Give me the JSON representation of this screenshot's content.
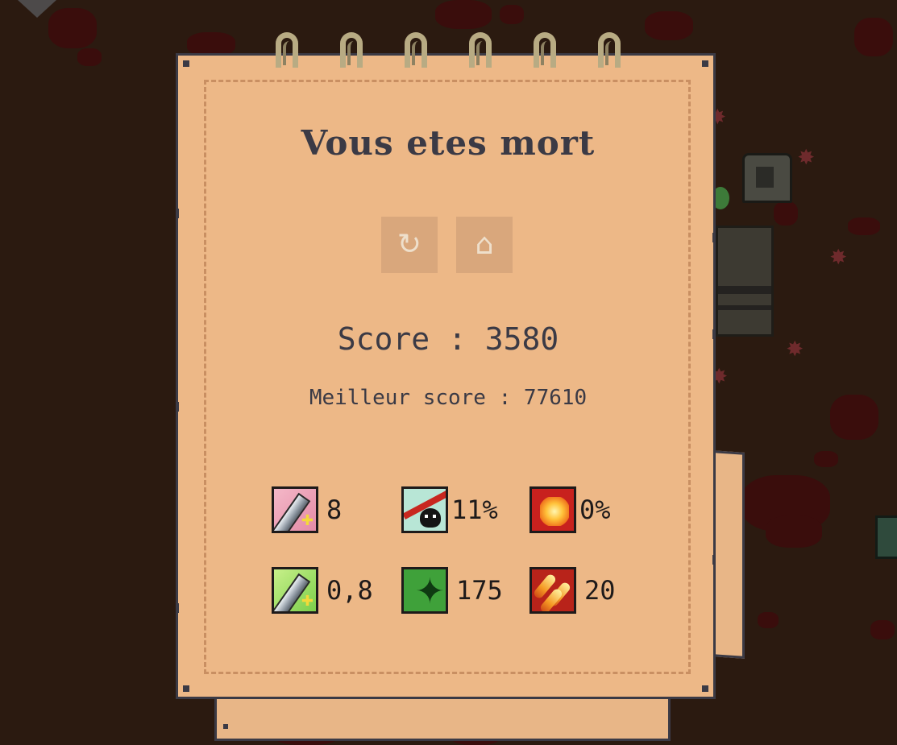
{
  "game_over": {
    "title": "Vous etes mort",
    "score_text": "Score : 3580",
    "best_score_text": "Meilleur score : 77610"
  },
  "buttons": {
    "restart_icon": "restart-icon",
    "home_icon": "home-icon"
  },
  "stats": [
    {
      "icon": "damage-up-icon",
      "value": "8"
    },
    {
      "icon": "critical-chance-icon",
      "value": "11%"
    },
    {
      "icon": "fire-chance-icon",
      "value": "0%"
    },
    {
      "icon": "attack-speed-icon",
      "value": "0,8"
    },
    {
      "icon": "dodge-icon",
      "value": "175"
    },
    {
      "icon": "fire-damage-icon",
      "value": "20"
    }
  ],
  "colors": {
    "paper": "#edb887",
    "ink": "#3b3a45",
    "button": "#d9a77c",
    "background": "#2b1a10"
  }
}
